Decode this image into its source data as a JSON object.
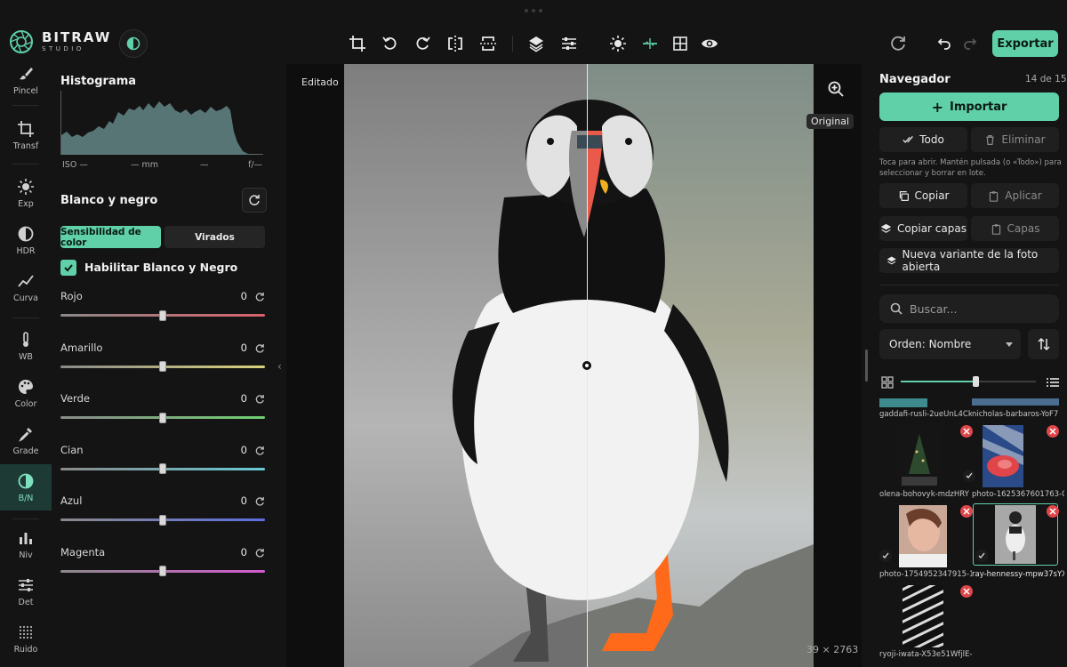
{
  "app": {
    "name": "BITRAW",
    "sub": "STUDIO"
  },
  "toolbar": {
    "export_label": "Exportar",
    "icons": [
      "crop-icon",
      "rotate-left-icon",
      "rotate-right-icon",
      "flip-horizontal-icon",
      "flip-vertical-icon",
      "layers-icon",
      "adjust-icon",
      "brightness-icon",
      "compare-icon",
      "grid-icon",
      "eye-icon",
      "refresh-icon",
      "undo-icon",
      "redo-icon"
    ]
  },
  "tools": [
    {
      "label": "Pincel",
      "icon": "brush-icon"
    },
    {
      "label": "Transf",
      "icon": "crop-icon"
    },
    {
      "label": "Exp",
      "icon": "sun-icon"
    },
    {
      "label": "HDR",
      "icon": "half-circle-icon"
    },
    {
      "label": "Curva",
      "icon": "curve-icon"
    },
    {
      "label": "WB",
      "icon": "thermometer-icon"
    },
    {
      "label": "Color",
      "icon": "palette-icon"
    },
    {
      "label": "Grade",
      "icon": "eyedropper-icon"
    },
    {
      "label": "B/N",
      "icon": "bw-icon"
    },
    {
      "label": "Niv",
      "icon": "levels-icon"
    },
    {
      "label": "Det",
      "icon": "sliders-icon"
    },
    {
      "label": "Ruido",
      "icon": "noise-icon"
    }
  ],
  "panel": {
    "histogram_title": "Histograma",
    "histo_meta": {
      "iso": "ISO —",
      "mm": "— mm",
      "mid": "—",
      "f": "f/—"
    },
    "section_title": "Blanco y negro",
    "seg_active": "Sensibilidad de color",
    "seg_inactive": "Virados",
    "enable_label": "Habilitar Blanco y Negro",
    "sliders": [
      {
        "name": "Rojo",
        "value": "0",
        "color": "#d9626a"
      },
      {
        "name": "Amarillo",
        "value": "0",
        "color": "#d8d27a"
      },
      {
        "name": "Verde",
        "value": "0",
        "color": "#6fcf72"
      },
      {
        "name": "Cian",
        "value": "0",
        "color": "#66c9d6"
      },
      {
        "name": "Azul",
        "value": "0",
        "color": "#5c6de0"
      },
      {
        "name": "Magenta",
        "value": "0",
        "color": "#d45ad0"
      }
    ]
  },
  "viewer": {
    "edited_label": "Editado",
    "original_label": "Original",
    "dims": "39 × 2763"
  },
  "navigator": {
    "title": "Navegador",
    "count": "14 de 15",
    "import_label": "Importar",
    "all_label": "Todo",
    "delete_label": "Eliminar",
    "hint": "Toca para abrir. Mantén pulsada (o «Todo») para seleccionar y borrar en lote.",
    "copy_label": "Copiar",
    "apply_label": "Aplicar",
    "copy_layers_label": "Copiar capas",
    "layers_label": "Capas",
    "new_variant_label": "Nueva variante de la foto abierta",
    "search_placeholder": "Buscar...",
    "sort_label": "Orden: Nombre",
    "thumb_size": 0.55,
    "thumbs": [
      {
        "name": "gaddafi-rusli-2ueUnL4Ck"
      },
      {
        "name": "nicholas-barbaros-YoF7"
      },
      {
        "name": "olena-bohovyk-mdzHRY"
      },
      {
        "name": "photo-1625367601763-0"
      },
      {
        "name": "photo-1754952347915-1f"
      },
      {
        "name": "ray-hennessy-mpw37sYX"
      },
      {
        "name": "ryoji-iwata-X53e51WfjlE-"
      }
    ]
  }
}
